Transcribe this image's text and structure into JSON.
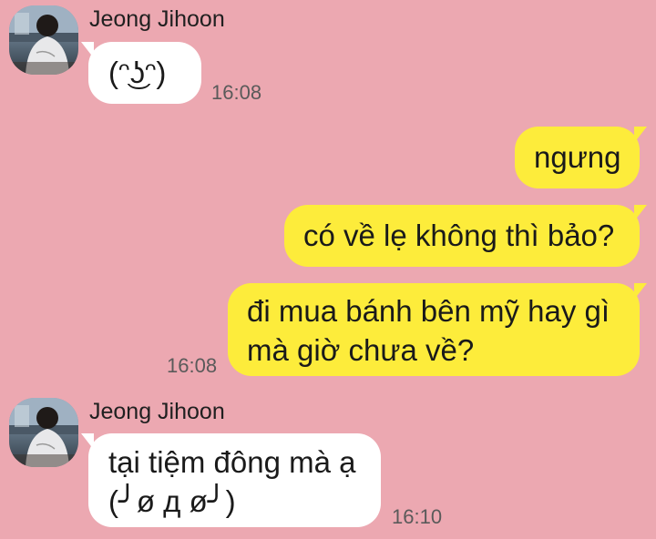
{
  "chat": {
    "messages": [
      {
        "sender": "Jeong Jihoon",
        "text": "(ᵔ͜ʖᵔ)",
        "time": "16:08"
      },
      {
        "text": "ngưng"
      },
      {
        "text": "có về lẹ không thì bảo?"
      },
      {
        "text": "đi mua bánh bên mỹ hay gì\nmà giờ chưa về?",
        "time": "16:08"
      },
      {
        "sender": "Jeong Jihoon",
        "text": "tại tiệm đông mà ạ\n(╯ø д ø╯)",
        "time": "16:10"
      }
    ]
  },
  "colors": {
    "background": "#eca8b1",
    "incoming_bubble": "#ffffff",
    "outgoing_bubble": "#fdec3b"
  },
  "icons": {
    "avatar": "profile-photo"
  }
}
